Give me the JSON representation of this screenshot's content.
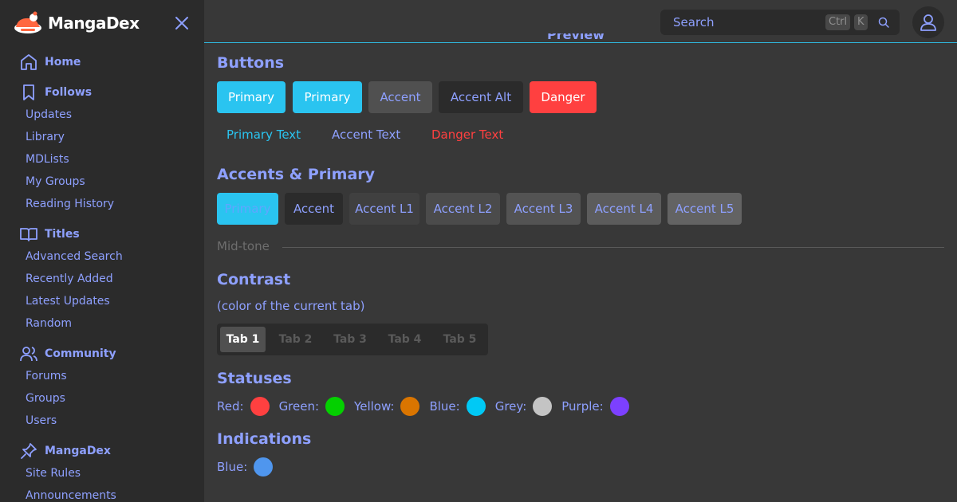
{
  "brand": {
    "name": "MangaDex"
  },
  "sidebar": {
    "groups": [
      {
        "head": "Home",
        "icon": "home-icon",
        "items": []
      },
      {
        "head": "Follows",
        "icon": "bookmark-icon",
        "items": [
          "Updates",
          "Library",
          "MDLists",
          "My Groups",
          "Reading History"
        ]
      },
      {
        "head": "Titles",
        "icon": "book-icon",
        "items": [
          "Advanced Search",
          "Recently Added",
          "Latest Updates",
          "Random"
        ]
      },
      {
        "head": "Community",
        "icon": "users-icon",
        "items": [
          "Forums",
          "Groups",
          "Users"
        ]
      },
      {
        "head": "MangaDex",
        "icon": "pin-icon",
        "items": [
          "Site Rules",
          "Announcements"
        ]
      }
    ]
  },
  "header": {
    "search_placeholder": "Search",
    "kbd_ctrl": "Ctrl",
    "kbd_k": "K",
    "preview_label": "Preview"
  },
  "sections": {
    "buttons": {
      "title": "Buttons",
      "items": [
        "Primary",
        "Primary",
        "Accent",
        "Accent Alt",
        "Danger"
      ],
      "text_items": [
        "Primary Text",
        "Accent Text",
        "Danger Text"
      ]
    },
    "accents": {
      "title": "Accents & Primary",
      "items": [
        "Primary",
        "Accent",
        "Accent L1",
        "Accent L2",
        "Accent L3",
        "Accent L4",
        "Accent L5"
      ]
    },
    "midtone": {
      "label": "Mid-tone"
    },
    "contrast": {
      "title": "Contrast",
      "subtitle": "(color of the current tab)",
      "tabs": [
        "Tab 1",
        "Tab 2",
        "Tab 3",
        "Tab 4",
        "Tab 5"
      ]
    },
    "statuses": {
      "title": "Statuses",
      "items": [
        {
          "label": "Red:",
          "color": "#ff4040"
        },
        {
          "label": "Green:",
          "color": "#04d000"
        },
        {
          "label": "Yellow:",
          "color": "#da7500"
        },
        {
          "label": "Blue:",
          "color": "#00c9f5"
        },
        {
          "label": "Grey:",
          "color": "#c4c4c4"
        },
        {
          "label": "Purple:",
          "color": "#7c40ff"
        }
      ]
    },
    "indications": {
      "title": "Indications",
      "items": [
        {
          "label": "Blue:",
          "color": "#4f96ee"
        }
      ]
    }
  },
  "colors": {
    "primary": "#2ac4f0",
    "accent": "#8ea0ff",
    "danger": "#ff4040",
    "sidebar_bg": "#2b2b2b",
    "page_bg": "#383838"
  }
}
